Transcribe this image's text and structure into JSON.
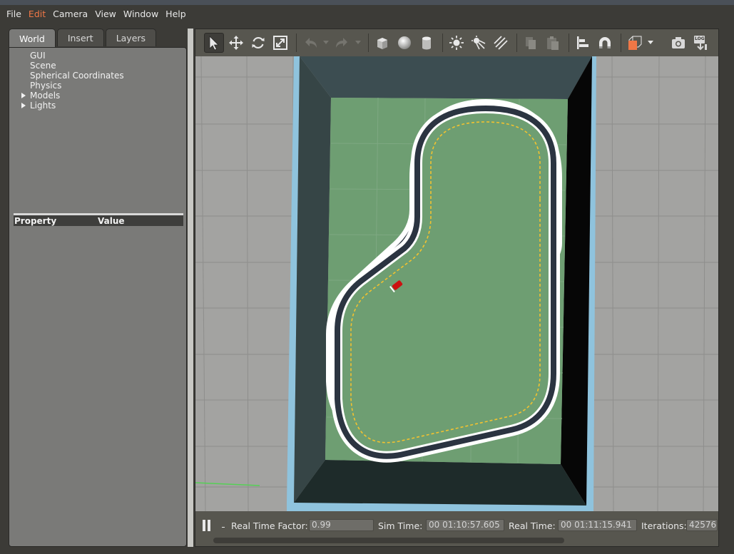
{
  "menubar": {
    "items": [
      {
        "label": "File",
        "active": false
      },
      {
        "label": "Edit",
        "active": true
      },
      {
        "label": "Camera",
        "active": false
      },
      {
        "label": "View",
        "active": false
      },
      {
        "label": "Window",
        "active": false
      },
      {
        "label": "Help",
        "active": false
      }
    ]
  },
  "left_panel": {
    "tabs": [
      {
        "label": "World",
        "active": true
      },
      {
        "label": "Insert",
        "active": false
      },
      {
        "label": "Layers",
        "active": false
      }
    ],
    "tree": [
      {
        "label": "GUI",
        "expandable": false
      },
      {
        "label": "Scene",
        "expandable": false
      },
      {
        "label": "Spherical Coordinates",
        "expandable": false
      },
      {
        "label": "Physics",
        "expandable": false
      },
      {
        "label": "Models",
        "expandable": true
      },
      {
        "label": "Lights",
        "expandable": true
      }
    ],
    "property_header": {
      "property": "Property",
      "value": "Value"
    }
  },
  "toolbar": {
    "tools": [
      "select-arrow-icon",
      "translate-icon",
      "rotate-icon",
      "scale-icon",
      "undo-icon",
      "redo-icon",
      "box-icon",
      "sphere-icon",
      "cylinder-icon",
      "point-light-icon",
      "spot-light-icon",
      "directional-light-icon",
      "copy-icon",
      "paste-icon",
      "align-icon",
      "magnet-icon",
      "view-angle-icon",
      "screenshot-icon",
      "log-icon"
    ],
    "log_label": "LOG"
  },
  "statusbar": {
    "real_time_factor_label": "Real Time Factor:",
    "real_time_factor": "0.99",
    "sim_time_label": "Sim Time:",
    "sim_time": "00 01:10:57.605",
    "real_time_label": "Real Time:",
    "real_time": "00 01:11:15.941",
    "iterations_label": "Iterations:",
    "iterations": "42576"
  },
  "colors": {
    "accent": "#f07746",
    "ground": "#6e9e72",
    "road": "#2b3441",
    "lane": "#f2c230",
    "car": "#cc1111"
  }
}
